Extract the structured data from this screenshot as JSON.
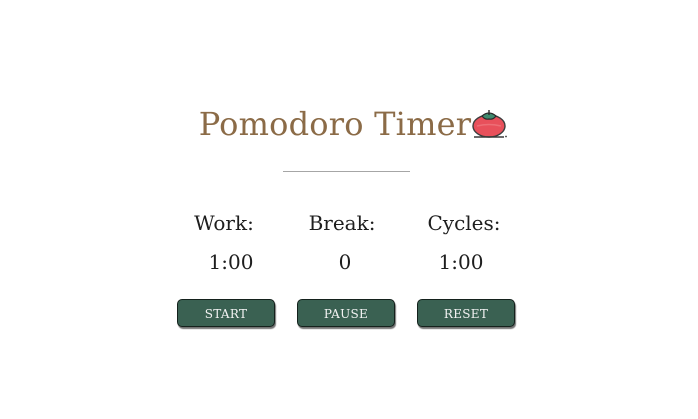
{
  "app": {
    "title": "Pomodoro Timer",
    "title_icon": "tomato-icon"
  },
  "stats": {
    "work": {
      "label": "Work:",
      "value": "1:00"
    },
    "break": {
      "label": "Break:",
      "value": "0"
    },
    "cycles": {
      "label": "Cycles:",
      "value": "1:00"
    }
  },
  "controls": {
    "start_label": "START",
    "pause_label": "PAUSE",
    "reset_label": "RESET"
  },
  "colors": {
    "title": "#8b6b47",
    "button_bg": "#3a6152",
    "button_text": "#f3f3f3",
    "divider": "#a6a6a6",
    "tomato": "#e8505b",
    "tomato_leaf": "#3f8a6e"
  }
}
